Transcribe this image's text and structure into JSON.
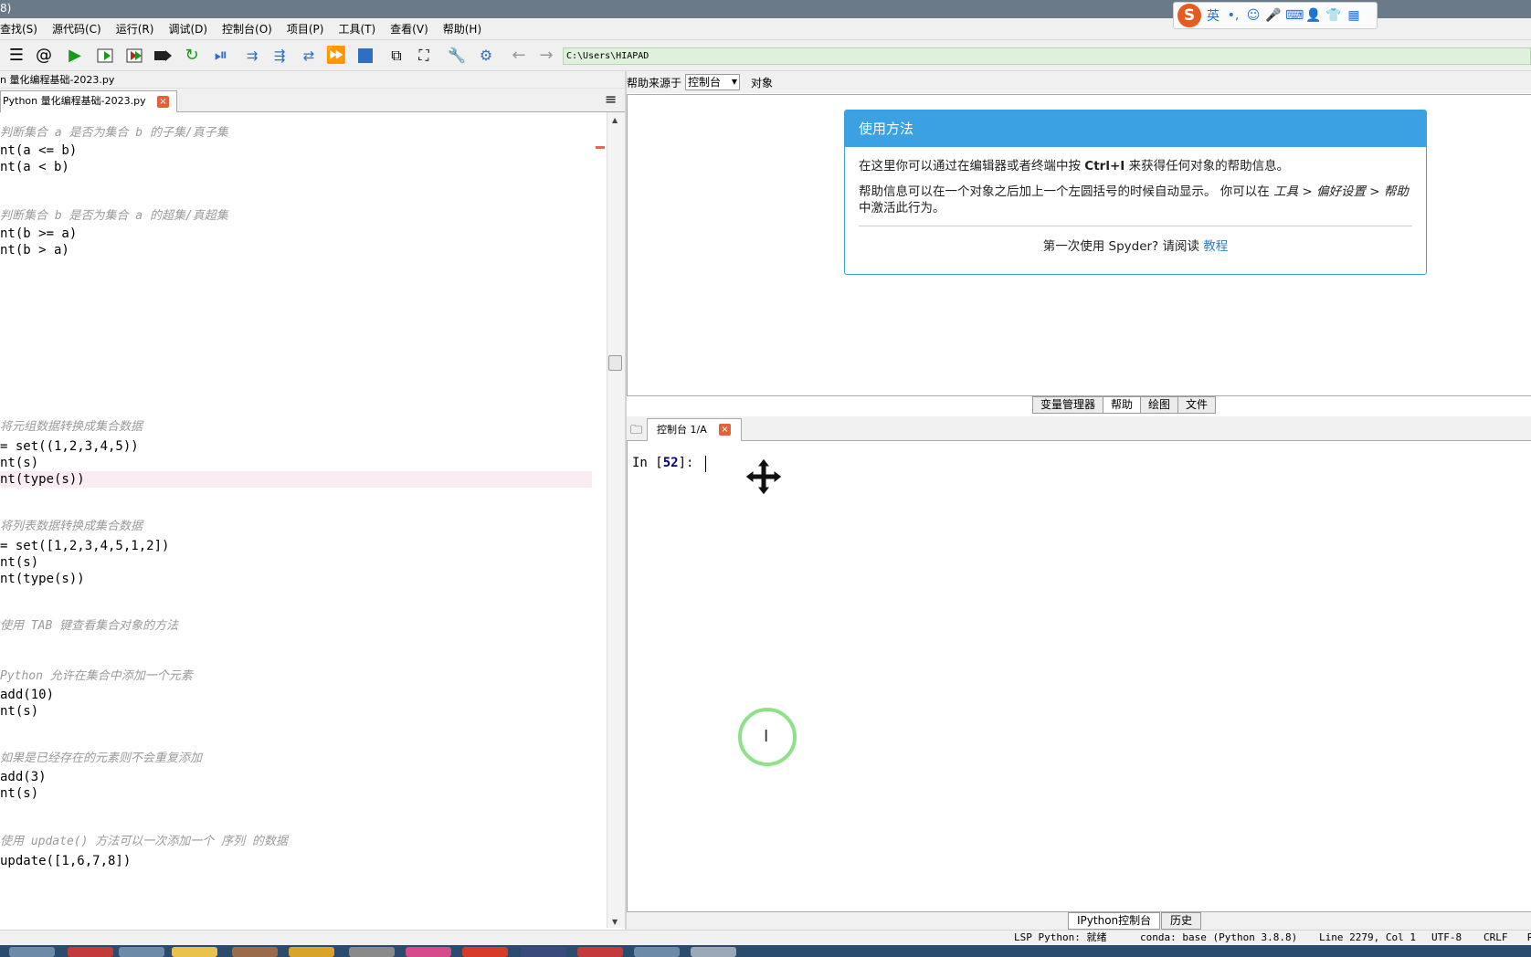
{
  "window": {
    "title_fragment": "8)"
  },
  "ime": {
    "logo": "S",
    "icons": [
      "英",
      "•,",
      "☺",
      "🎤",
      "⌨",
      "👤",
      "👕",
      "▦"
    ]
  },
  "menu": {
    "items": [
      "查找(S)",
      "源代码(C)",
      "运行(R)",
      "调试(D)",
      "控制台(O)",
      "项目(P)",
      "工具(T)",
      "查看(V)",
      "帮助(H)"
    ]
  },
  "toolbar": {
    "working_dir": "C:\\Users\\HIAPAD"
  },
  "editor": {
    "file_path": "n 量化编程基础-2023.py",
    "tab_label": "Python 量化编程基础-2023.py",
    "tab_close": "×",
    "menu_icon": "≡",
    "lines": [
      {
        "text": "判断集合 a 是否为集合 b 的子集/真子集",
        "comment": true
      },
      {
        "text": "nt(a <= b)",
        "comment": false
      },
      {
        "text": "nt(a < b)",
        "comment": false
      },
      {
        "text": "判断集合 b 是否为集合 a 的超集/真超集",
        "comment": true
      },
      {
        "text": "nt(b >= a)",
        "comment": false
      },
      {
        "text": "nt(b > a)",
        "comment": false
      },
      {
        "text": "将元组数据转换成集合数据",
        "comment": true
      },
      {
        "text": "= set((1,2,3,4,5))",
        "comment": false
      },
      {
        "text": "nt(s)",
        "comment": false
      },
      {
        "text": "nt(type(s))",
        "comment": false
      },
      {
        "text": "将列表数据转换成集合数据",
        "comment": true
      },
      {
        "text": "= set([1,2,3,4,5,1,2])",
        "comment": false
      },
      {
        "text": "nt(s)",
        "comment": false
      },
      {
        "text": "nt(type(s))",
        "comment": false
      },
      {
        "text": "使用 TAB 键查看集合对象的方法",
        "comment": true
      },
      {
        "text": "Python 允许在集合中添加一个元素",
        "comment": true
      },
      {
        "text": "add(10)",
        "comment": false
      },
      {
        "text": "nt(s)",
        "comment": false
      },
      {
        "text": "如果是已经存在的元素则不会重复添加",
        "comment": true
      },
      {
        "text": "add(3)",
        "comment": false
      },
      {
        "text": "nt(s)",
        "comment": false
      },
      {
        "text": "使用 update() 方法可以一次添加一个 序列 的数据",
        "comment": true
      },
      {
        "text": "update([1,6,7,8])",
        "comment": false
      }
    ]
  },
  "help": {
    "source_label": "帮助来源于",
    "source_value": "控制台",
    "object_label": "对象",
    "card_title": "使用方法",
    "para1_pre": "在这里你可以通过在编辑器或者终端中按 ",
    "para1_key": "Ctrl+I",
    "para1_post": " 来获得任何对象的帮助信息。",
    "para2_pre": "帮助信息可以在一个对象之后加上一个左圆括号的时候自动显示。 你可以在 ",
    "para2_path": "工具 > 偏好设置 > 帮助",
    "para2_post": " 中激活此行为。",
    "footer_pre": "第一次使用 Spyder? 请阅读 ",
    "footer_link": "教程"
  },
  "pane_tabs": [
    "变量管理器",
    "帮助",
    "绘图",
    "文件"
  ],
  "pane_tab_active": "帮助",
  "console": {
    "tab_label": "控制台 1/A",
    "tab_close": "×",
    "prompt_pre": "In [",
    "prompt_num": "52",
    "prompt_post": "]:"
  },
  "bottom_tabs": [
    "IPython控制台",
    "历史"
  ],
  "status": {
    "lsp": "LSP Python: 就绪",
    "conda": "conda: base (Python 3.8.8)",
    "position": "Line 2279, Col 1",
    "encoding": "UTF-8",
    "eol": "CRLF",
    "rw": "R"
  },
  "colors": {
    "accent": "#3ba1e3",
    "comment": "#9a9a9a",
    "current_line": "#fbecf3",
    "path_bg": "#dff0dc"
  }
}
